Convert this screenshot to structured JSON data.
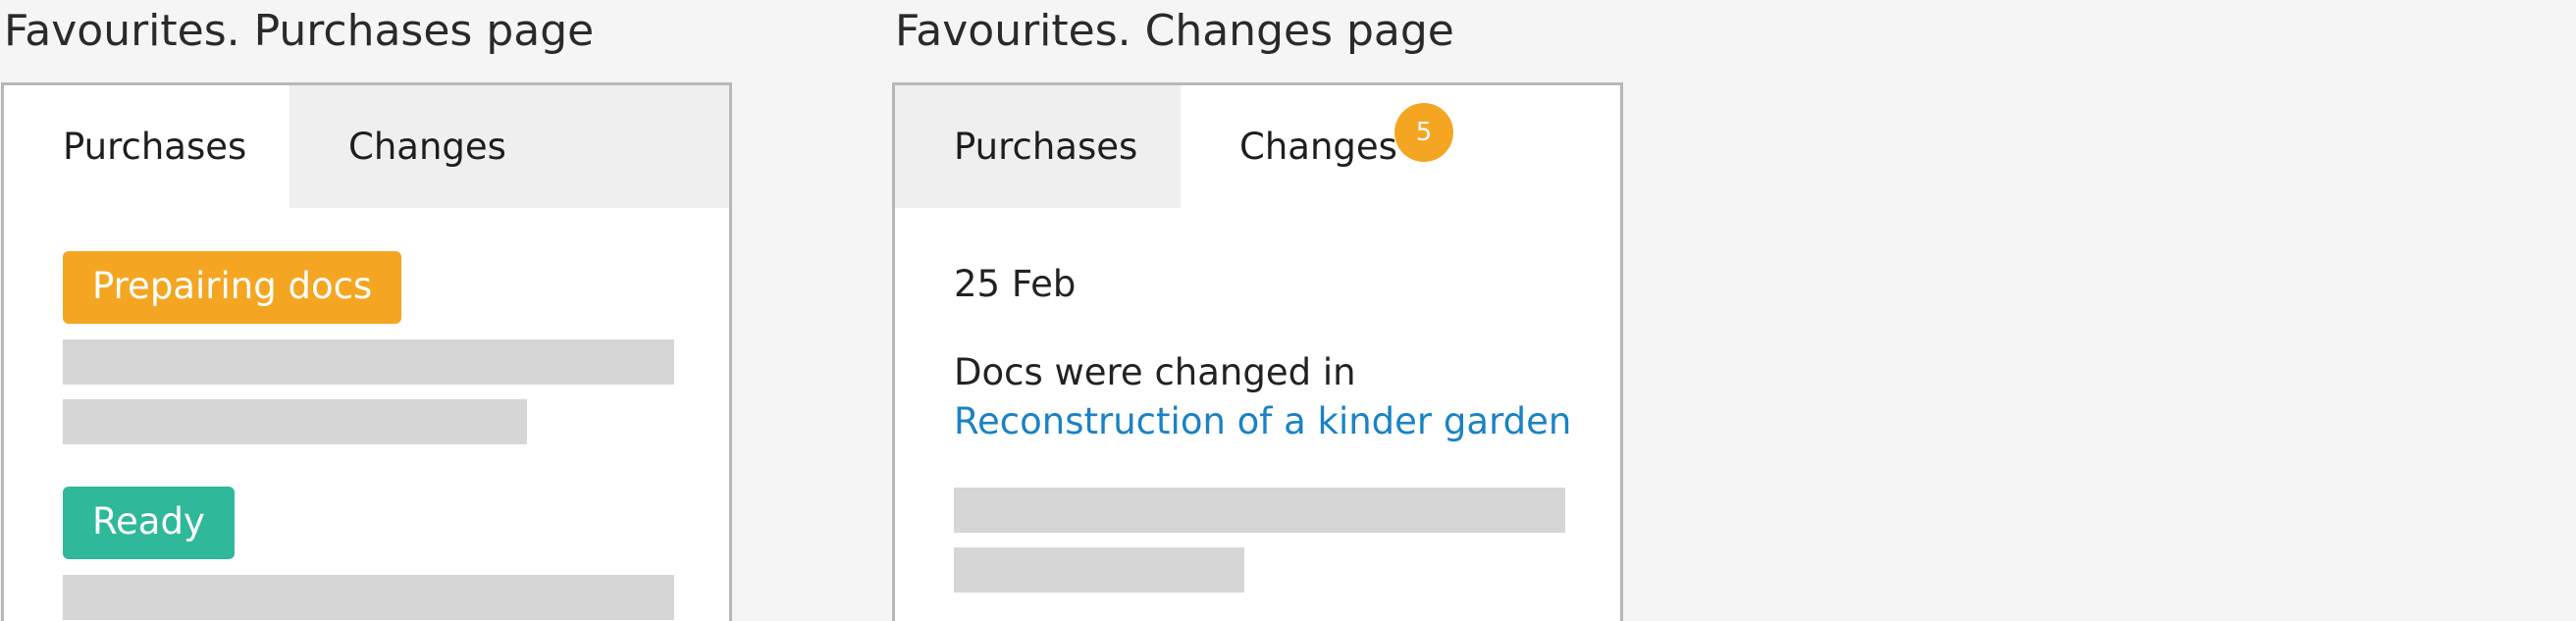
{
  "left": {
    "caption": "Favourites. Purchases page",
    "tabs": [
      {
        "label": "Purchases",
        "active": true
      },
      {
        "label": "Changes",
        "active": false
      }
    ],
    "items": [
      {
        "status": "Prepairing docs",
        "color": "#f4a623"
      },
      {
        "status": "Ready",
        "color": "#2fb89a"
      }
    ]
  },
  "right": {
    "caption": "Favourites. Changes page",
    "tabs": [
      {
        "label": "Purchases",
        "active": false
      },
      {
        "label": "Changes",
        "active": true,
        "badge": "5"
      }
    ],
    "date": "25 Feb",
    "message": "Docs were changed in",
    "link_text": "Reconstruction of a kinder garden"
  },
  "colors": {
    "orange": "#f4a623",
    "green": "#2fb89a",
    "link": "#1a82c4",
    "placeholder": "#d6d6d6"
  }
}
